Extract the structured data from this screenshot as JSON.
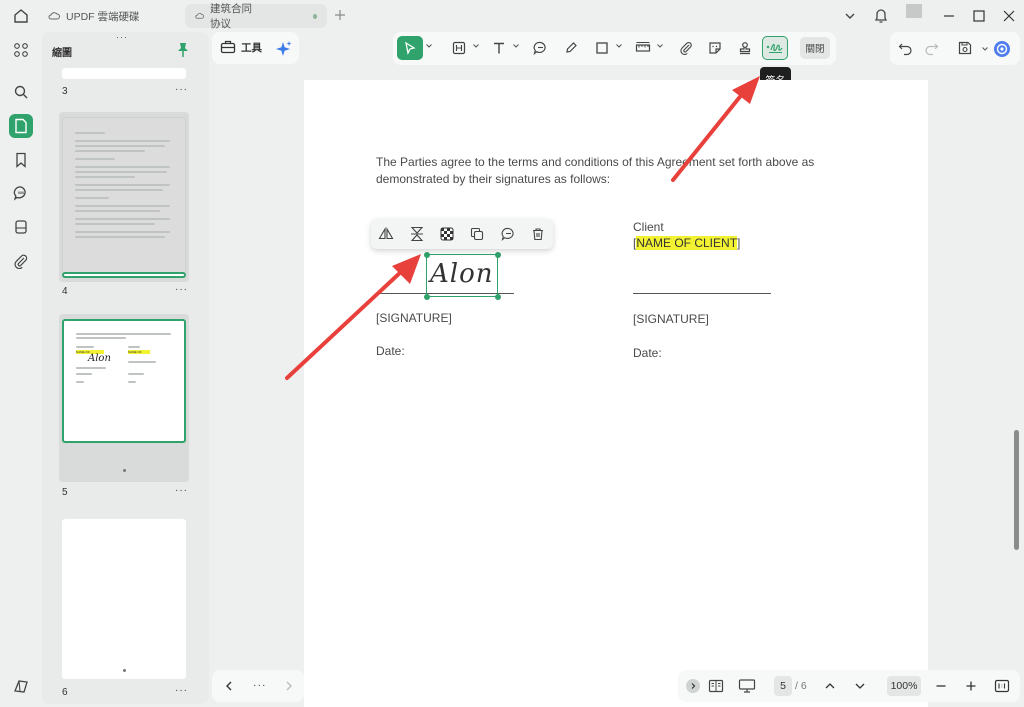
{
  "tabs": [
    {
      "label": "UPDF 雲端硬碟"
    },
    {
      "label": "建筑合同协议"
    }
  ],
  "sidebar": {
    "title": "縮圖",
    "pages": [
      {
        "number": "3",
        "more": "···"
      },
      {
        "number": "4",
        "more": "···"
      },
      {
        "number": "5",
        "more": "···"
      },
      {
        "number": "6",
        "more": "···"
      }
    ],
    "thumb5": {
      "highlight_left": "NAME OF CONTRACTOR",
      "highlight_right": "NAME OF CLIENT",
      "signature": "Alon"
    }
  },
  "tools": {
    "label": "工具"
  },
  "toolbar": {
    "close_label": "關閉",
    "tooltip": "簽名"
  },
  "document": {
    "paragraph_line1": "The Parties agree to the terms and conditions of this Agreement set forth above as",
    "paragraph_line2": "demonstrated by their signatures as follows:",
    "client_label": "Client",
    "client_open": "[",
    "client_name": "NAME OF CLIENT",
    "client_close": "]",
    "signature_left": "[SIGNATURE]",
    "signature_right": "[SIGNATURE]",
    "date_left": "Date:",
    "date_right": "Date:",
    "signature_value": "Alon"
  },
  "bottom": {
    "more": "···",
    "page_current": "5",
    "page_total": "/ 6",
    "zoom": "100%"
  },
  "colors": {
    "accent": "#2fa36b",
    "highlight": "#f2f233",
    "arrow": "#e8413c"
  }
}
